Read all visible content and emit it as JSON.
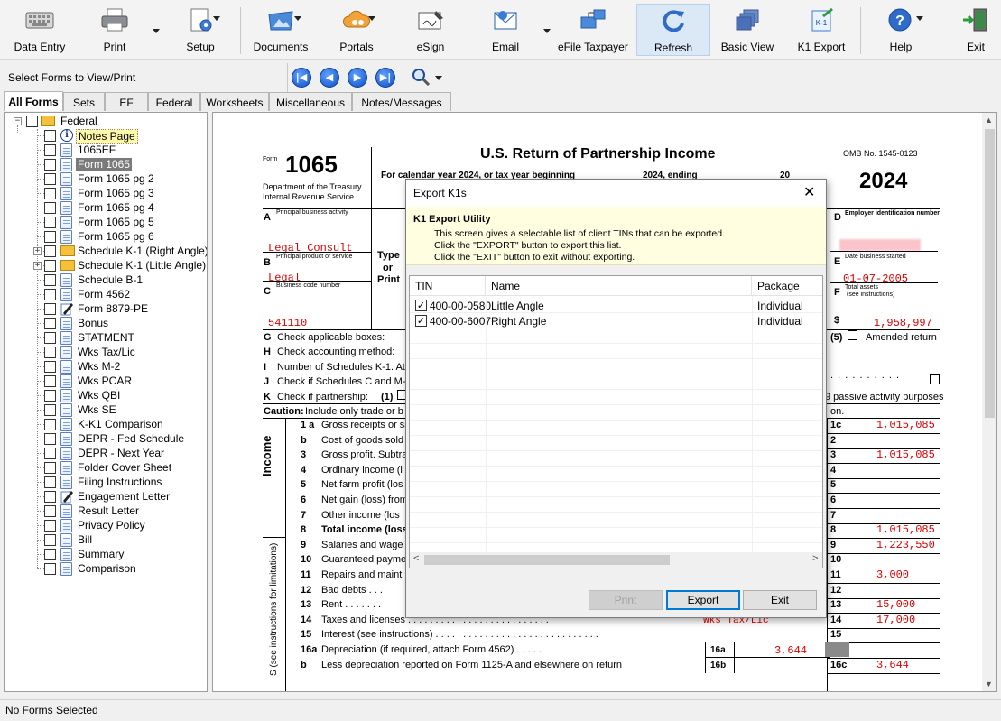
{
  "toolbar": {
    "buttons": [
      {
        "label": "Data Entry",
        "icon": "keyboard-icon"
      },
      {
        "label": "Print",
        "icon": "printer-icon"
      },
      {
        "label": "Setup",
        "icon": "setup-icon"
      },
      {
        "label": "Documents",
        "icon": "documents-icon"
      },
      {
        "label": "Portals",
        "icon": "cloud-icon"
      },
      {
        "label": "eSign",
        "icon": "esign-icon"
      },
      {
        "label": "Email",
        "icon": "email-icon"
      },
      {
        "label": "eFile Taxpayer",
        "icon": "efile-icon"
      },
      {
        "label": "Refresh",
        "icon": "refresh-icon"
      },
      {
        "label": "Basic View",
        "icon": "basic-view-icon"
      },
      {
        "label": "K1 Export",
        "icon": "k1-export-icon",
        "icon_text": "K-1"
      },
      {
        "label": "Help",
        "icon": "help-icon",
        "icon_text": "?"
      },
      {
        "label": "Exit",
        "icon": "exit-door-icon"
      }
    ]
  },
  "selector": {
    "label": "Select Forms to View/Print",
    "nav": [
      "|◀",
      "◀",
      "▶",
      "▶|"
    ]
  },
  "tabs": [
    "All Forms",
    "Sets",
    "EF",
    "Federal",
    "Worksheets",
    "Miscellaneous",
    "Notes/Messages"
  ],
  "tree": {
    "root": "Federal",
    "items": [
      {
        "label": "Notes Page",
        "icon": "info-icon"
      },
      {
        "label": "1065EF",
        "icon": "document-icon"
      },
      {
        "label": "Form 1065",
        "icon": "document-icon"
      },
      {
        "label": "Form 1065 pg 2",
        "icon": "document-icon"
      },
      {
        "label": "Form 1065 pg 3",
        "icon": "document-icon"
      },
      {
        "label": "Form 1065 pg 4",
        "icon": "document-icon"
      },
      {
        "label": "Form 1065 pg 5",
        "icon": "document-icon"
      },
      {
        "label": "Form 1065 pg 6",
        "icon": "document-icon"
      },
      {
        "label": "Schedule K-1 (Right Angle)",
        "icon": "folder-icon"
      },
      {
        "label": "Schedule K-1 (Little Angle)",
        "icon": "folder-icon"
      },
      {
        "label": "Schedule B-1",
        "icon": "document-icon"
      },
      {
        "label": "Form 4562",
        "icon": "document-icon"
      },
      {
        "label": "Form 8879-PE",
        "icon": "pen-icon"
      },
      {
        "label": "Bonus",
        "icon": "document-icon"
      },
      {
        "label": "STATMENT",
        "icon": "document-icon"
      },
      {
        "label": "Wks Tax/Lic",
        "icon": "document-icon"
      },
      {
        "label": "Wks M-2",
        "icon": "document-icon"
      },
      {
        "label": "Wks PCAR",
        "icon": "document-icon"
      },
      {
        "label": "Wks QBI",
        "icon": "document-icon"
      },
      {
        "label": "Wks SE",
        "icon": "document-icon"
      },
      {
        "label": "K-K1 Comparison",
        "icon": "document-icon"
      },
      {
        "label": "DEPR - Fed Schedule",
        "icon": "document-icon"
      },
      {
        "label": "DEPR - Next Year",
        "icon": "document-icon"
      },
      {
        "label": "Folder Cover Sheet",
        "icon": "document-icon"
      },
      {
        "label": "Filing Instructions",
        "icon": "document-icon"
      },
      {
        "label": "Engagement Letter",
        "icon": "pen-icon"
      },
      {
        "label": "Result Letter",
        "icon": "document-icon"
      },
      {
        "label": "Privacy Policy",
        "icon": "document-icon"
      },
      {
        "label": "Bill",
        "icon": "document-icon"
      },
      {
        "label": "Summary",
        "icon": "document-icon"
      },
      {
        "label": "Comparison",
        "icon": "document-icon"
      }
    ]
  },
  "form": {
    "form_word": "Form",
    "form_number": "1065",
    "title": "U.S. Return of Partnership Income",
    "calendar_line": "For calendar year 2024, or tax year beginning",
    "calendar_mid": "2024, ending",
    "calendar_end": "20",
    "omb": "OMB No. 1545-0123",
    "year": "2024",
    "dept1": "Department of the Treasury",
    "dept2": "Internal Revenue Service",
    "A_letter": "A",
    "A_label": "Principal business activity",
    "A_value": "Legal Consult",
    "B_letter": "B",
    "B_label": "Principal product or service",
    "B_value": "Legal",
    "C_letter": "C",
    "C_label": "Business code number",
    "C_value": "541110",
    "type_or_print": [
      "Type",
      "or",
      "Print"
    ],
    "D_letter": "D",
    "D_label": "Employer identification number",
    "E_letter": "E",
    "E_label": "Date business started",
    "E_value": "01-07-2005",
    "F_letter": "F",
    "F_label1": "Total assets",
    "F_label2": "(see instructions)",
    "F_dollar": "$",
    "F_value": "1,958,997",
    "G": "Check applicable boxes:",
    "G_letter": "G",
    "H": "Check accounting method:",
    "H_letter": "H",
    "I": "Number of Schedules K-1. At",
    "I_letter": "I",
    "J": "Check if Schedules C and M-",
    "J_letter": "J",
    "K": "Check if partnership:",
    "K_letter": "K",
    "K_opt": "(1)",
    "opt5": "(5)",
    "amended": "Amended return",
    "passive": "9 passive activity purposes",
    "caution_bold": "Caution:",
    "caution_text": "Include only trade or b",
    "caution_end": "on.",
    "income_label": "Income",
    "deductions_label": "(see instructions for limitations)",
    "deductions_label2": "S (see instructions for limitations)",
    "lines": [
      {
        "num": "1 a",
        "text": "Gross receipts or sal",
        "box": "1c",
        "value": "1,015,085"
      },
      {
        "num": "b",
        "text": "Cost of goods sold",
        "box": "2",
        "value": ""
      },
      {
        "num": "3",
        "text": "Gross profit. Subtra",
        "box": "3",
        "value": "1,015,085"
      },
      {
        "num": "4",
        "text": "Ordinary income (l",
        "box": "4",
        "value": ""
      },
      {
        "num": "5",
        "text": "Net farm profit (los",
        "box": "5",
        "value": ""
      },
      {
        "num": "6",
        "text": "Net gain (loss) from",
        "box": "6",
        "value": ""
      },
      {
        "num": "7",
        "text": "Other income (los",
        "box": "7",
        "value": ""
      },
      {
        "num": "8",
        "text": "Total income (loss",
        "box": "8",
        "value": "1,015,085"
      },
      {
        "num": "9",
        "text": "Salaries and wage",
        "box": "9",
        "value": "1,223,550"
      },
      {
        "num": "10",
        "text": "Guaranteed payme",
        "box": "10",
        "value": ""
      },
      {
        "num": "11",
        "text": "Repairs and maint",
        "box": "11",
        "value": "3,000"
      },
      {
        "num": "12",
        "text": "Bad debts  . . .",
        "box": "12",
        "value": ""
      },
      {
        "num": "13",
        "text": "Rent  . . . . . . .",
        "box": "13",
        "value": "15,000"
      },
      {
        "num": "14",
        "text": "Taxes and licenses  . . . . . . . . . . . . . . . . . . . . . . . . . .",
        "box": "14",
        "value": "17,000"
      },
      {
        "num": "15",
        "text": "Interest (see instructions)  . . . . . . . . . . . . . . . . . . . . . . . . . . . . . .",
        "box": "15",
        "value": ""
      },
      {
        "num": "16a",
        "text": "Depreciation (if required, attach Form 4562)  . . . . .",
        "box": "",
        "value": ""
      },
      {
        "num": "b",
        "text": "Less depreciation reported on Form 1125-A and elsewhere on return",
        "box": "16c",
        "value": "3,644"
      }
    ],
    "box_16a": "16a",
    "value_16a": "3,644",
    "box_16b": "16b",
    "wks_note": "Wks Tax/Lic",
    "dotted": ". . . . . . . . . ."
  },
  "dialog": {
    "title": "Export K1s",
    "heading": "K1 Export Utility",
    "info": [
      "This screen gives a selectable list of client TINs that can be exported.",
      "Click the \"EXPORT\" button to export this list.",
      "Click the \"EXIT\" button to exit without exporting."
    ],
    "columns": [
      "TIN",
      "Name",
      "Package"
    ],
    "rows": [
      {
        "tin": "400-00-0580",
        "name": "Little Angle",
        "package": "Individual",
        "checked": true
      },
      {
        "tin": "400-00-6007",
        "name": "Right Angle",
        "package": "Individual",
        "checked": true
      }
    ],
    "buttons": {
      "print": "Print",
      "export": "Export",
      "exit": "Exit"
    },
    "close": "✕",
    "scroll_left": "<",
    "scroll_right": ">"
  },
  "status": {
    "text": "No Forms Selected"
  },
  "colors": {
    "accent": "#0078d7",
    "highlight": "#fff8a8",
    "form_red": "#dd0000"
  }
}
